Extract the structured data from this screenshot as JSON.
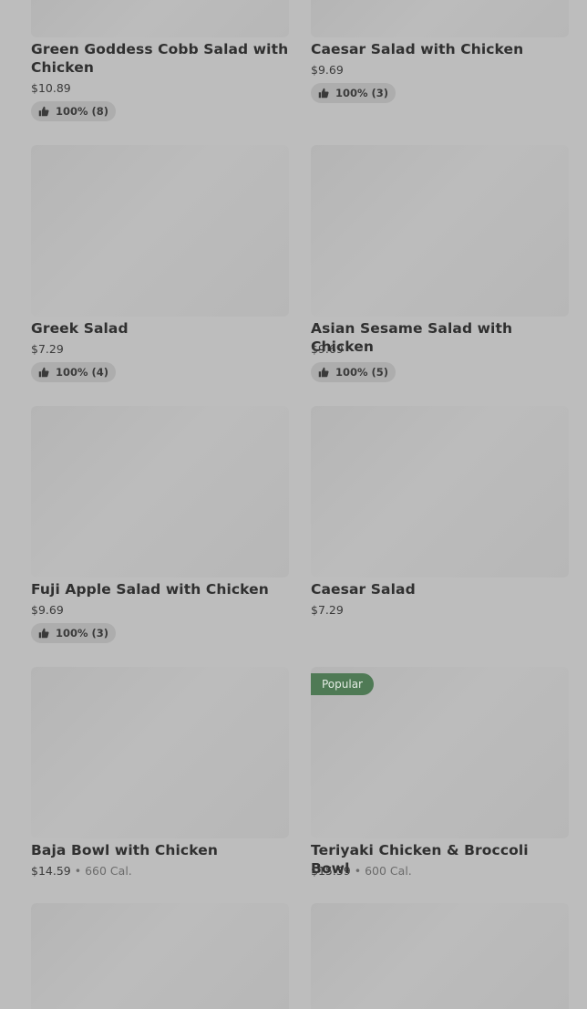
{
  "items": [
    {
      "name": "Green Goddess Cobb Salad with Chicken",
      "price": "$10.89",
      "rating": "100% (8)"
    },
    {
      "name": "Caesar Salad with Chicken",
      "price": "$9.69",
      "rating": "100% (3)"
    },
    {
      "name": "Greek Salad",
      "price": "$7.29",
      "rating": "100% (4)"
    },
    {
      "name": "Asian Sesame Salad with Chicken",
      "price": "$9.69",
      "rating": "100% (5)"
    },
    {
      "name": "Fuji Apple Salad with Chicken",
      "price": "$9.69",
      "rating": "100% (3)"
    },
    {
      "name": "Caesar Salad",
      "price": "$7.29"
    },
    {
      "name": "Baja Bowl with Chicken",
      "price": "$14.59",
      "calories": "660 Cal."
    },
    {
      "name": "Teriyaki Chicken & Broccoli Bowl",
      "price": "$15.59",
      "calories": "600 Cal.",
      "badge": "Popular"
    }
  ],
  "separator": "•",
  "icons": {
    "rating": "thumbs-up-icon"
  },
  "colors": {
    "badge_bg": "#4f7a55",
    "page_bg": "#bdbdbd"
  }
}
